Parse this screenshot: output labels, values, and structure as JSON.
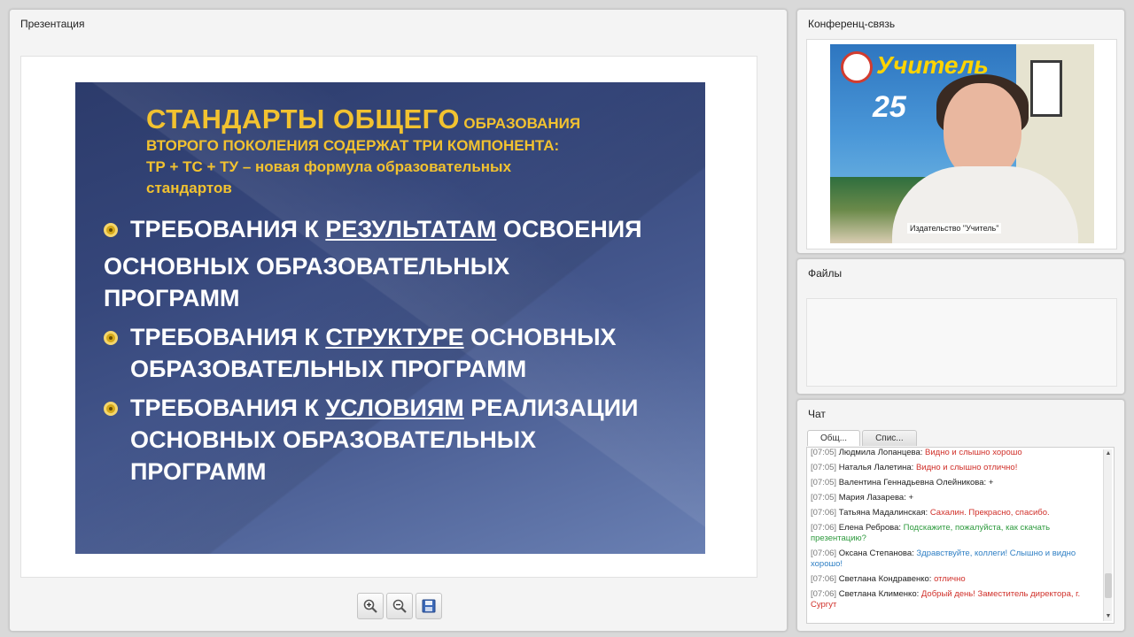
{
  "presentation": {
    "panel_title": "Презентация",
    "slide": {
      "title_big": "СТАНДАРТЫ ОБЩЕГО",
      "title_small": "ОБРАЗОВАНИЯ",
      "title_line2": "ВТОРОГО ПОКОЛЕНИЯ СОДЕРЖАТ ТРИ КОМПОНЕНТА:",
      "title_line3": "ТР + ТС + ТУ – новая формула образовательных",
      "title_line4": "стандартов",
      "bullets": [
        {
          "pre": "ТРЕБОВАНИЯ К ",
          "key": "РЕЗУЛЬТАТАМ",
          "post": " ОСВОЕНИЯ",
          "cont1": "ОСНОВНЫХ ОБРАЗОВАТЕЛЬНЫХ",
          "cont2": "ПРОГРАММ"
        },
        {
          "pre": "ТРЕБОВАНИЯ К ",
          "key": "СТРУКТУРЕ",
          "post": " ОСНОВНЫХ",
          "cont1": "ОБРАЗОВАТЕЛЬНЫХ ПРОГРАММ"
        },
        {
          "pre": "ТРЕБОВАНИЯ К ",
          "key": "УСЛОВИЯМ",
          "post": " РЕАЛИЗАЦИИ",
          "cont1": "ОСНОВНЫХ ОБРАЗОВАТЕЛЬНЫХ",
          "cont2": "ПРОГРАММ"
        }
      ]
    },
    "toolbar": {
      "zoom_in_icon": "zoom-in-icon",
      "zoom_out_icon": "zoom-out-icon",
      "save_icon": "save-icon"
    }
  },
  "conference": {
    "panel_title": "Конференц-связь",
    "video_label": "Издательство \"Учитель\"",
    "banner_brand": "Учитель",
    "banner_number": "25"
  },
  "files": {
    "panel_title": "Файлы"
  },
  "chat": {
    "panel_title": "Чат",
    "tabs": [
      "Общ...",
      "Спис..."
    ],
    "messages": [
      {
        "time": "[07:05]",
        "name": "Людмила Лопанцева:",
        "text": "Видно и слышно хорошо",
        "color": "#d0302a"
      },
      {
        "time": "[07:05]",
        "name": "Наталья Лалетина:",
        "text": "Видно и слышно отлично!",
        "color": "#d0302a"
      },
      {
        "time": "[07:05]",
        "name": "Валентина Геннадьевна Олейникова:",
        "text": "+",
        "color": "#222222"
      },
      {
        "time": "[07:05]",
        "name": "Мария Лазарева:",
        "text": "+",
        "color": "#222222"
      },
      {
        "time": "[07:06]",
        "name": "Татьяна Мадалинская:",
        "text": "Сахалин. Прекрасно, спасибо.",
        "color": "#d0302a"
      },
      {
        "time": "[07:06]",
        "name": "Елена Реброва:",
        "text": "Подскажите, пожалуйста, как скачать презентацию?",
        "color": "#2e9a3e"
      },
      {
        "time": "[07:06]",
        "name": "Оксана Степанова:",
        "text": "Здравствуйте, коллеги! Слышно и видно хорошо!",
        "color": "#2f7fc4"
      },
      {
        "time": "[07:06]",
        "name": "Светлана Кондравенко:",
        "text": "отлично",
        "color": "#d0302a"
      },
      {
        "time": "[07:06]",
        "name": "Светлана Клименко:",
        "text": "Добрый день! Заместитель директора, г. Сургут",
        "color": "#d0302a"
      }
    ]
  }
}
